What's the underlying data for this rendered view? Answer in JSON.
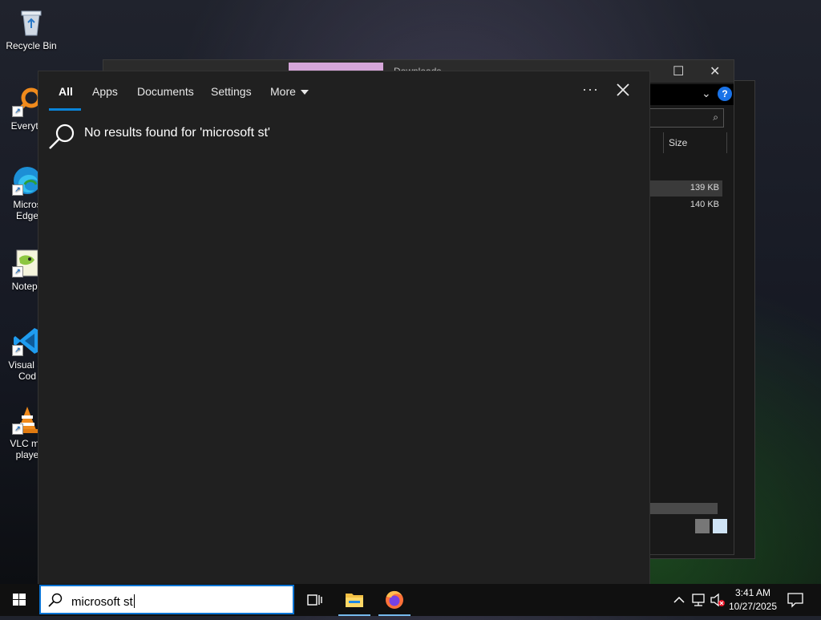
{
  "desktop": {
    "icons": [
      {
        "label": "Recycle Bin",
        "icon": "recycle-bin-icon"
      },
      {
        "label": "Everyth",
        "icon": "everything-search-icon"
      },
      {
        "label": "Micros\nEdge",
        "icon": "edge-icon"
      },
      {
        "label": "Notepa",
        "icon": "notepad-plus-plus-icon"
      },
      {
        "label": "Visual St\nCod",
        "icon": "vscode-icon"
      },
      {
        "label": "VLC me\nplaye",
        "icon": "vlc-icon"
      }
    ]
  },
  "background_window": {
    "title": "Downloads",
    "column_size": "Size",
    "sizes": [
      "139 KB",
      "140 KB"
    ]
  },
  "search_panel": {
    "tabs": [
      "All",
      "Apps",
      "Documents",
      "Settings",
      "More"
    ],
    "active_tab": "All",
    "more_icon": "ellipsis-icon",
    "close_icon": "close-icon",
    "result_message": "No results found for 'microsoft st'"
  },
  "taskbar": {
    "search_query": "microsoft st",
    "pinned": [
      "task-view-icon",
      "file-explorer-icon",
      "firefox-icon"
    ],
    "clock_time": "3:41 AM",
    "clock_date": "10/27/2025"
  },
  "colors": {
    "accent": "#0a84d8",
    "panel_bg": "#202020",
    "taskbar_bg": "#101010"
  }
}
